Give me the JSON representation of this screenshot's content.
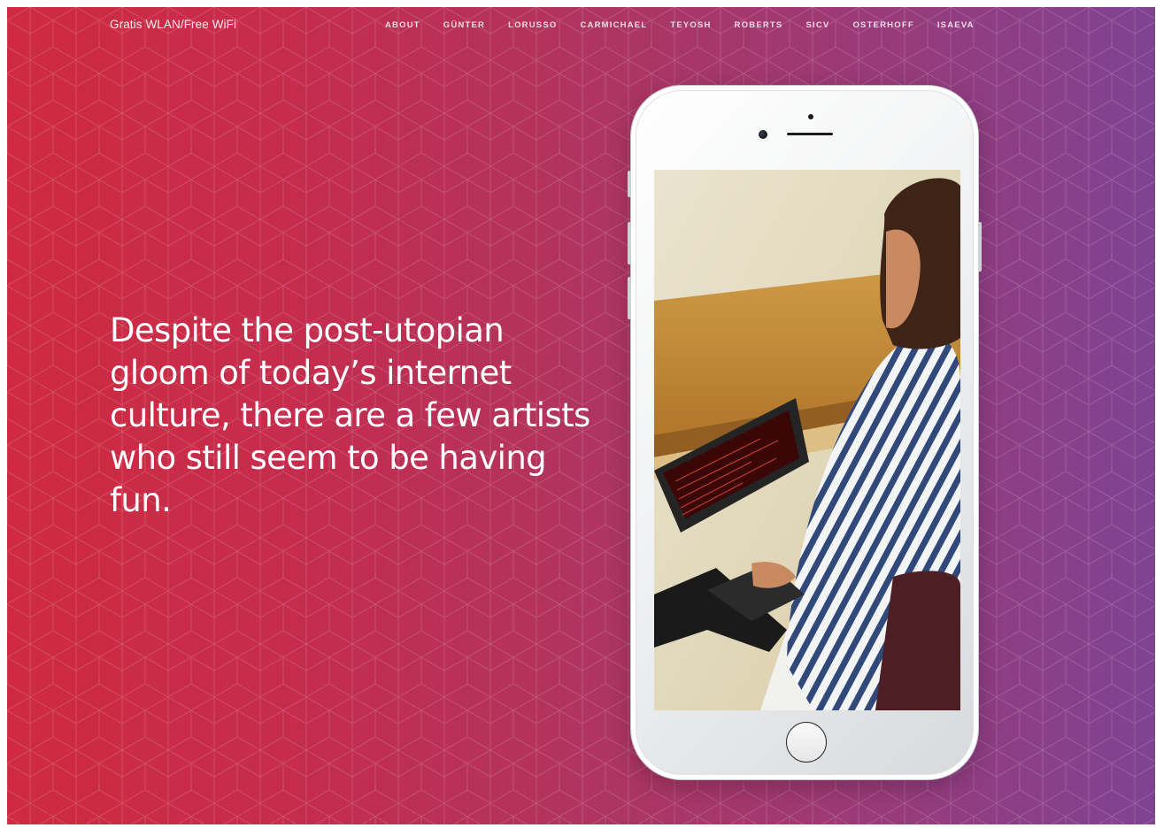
{
  "header": {
    "brand": "Gratis WLAN/Free WiFi",
    "nav": [
      {
        "label": "ABOUT"
      },
      {
        "label": "GÜNTER"
      },
      {
        "label": "LORUSSO"
      },
      {
        "label": "CARMICHAEL"
      },
      {
        "label": "TEYOSH"
      },
      {
        "label": "ROBERTS"
      },
      {
        "label": "SICV"
      },
      {
        "label": "OSTERHOFF"
      },
      {
        "label": "ISAEVA"
      }
    ]
  },
  "hero": {
    "headline": "Despite the post-utopian gloom of today’s internet culture, there are a few artists who still seem to be having fun."
  },
  "phone": {
    "icon": "smartphone-icon",
    "home_button_icon": "home-button-icon"
  },
  "colors": {
    "gradient_start": "#cf2a40",
    "gradient_end": "#7f4392",
    "text": "#ffffff"
  }
}
